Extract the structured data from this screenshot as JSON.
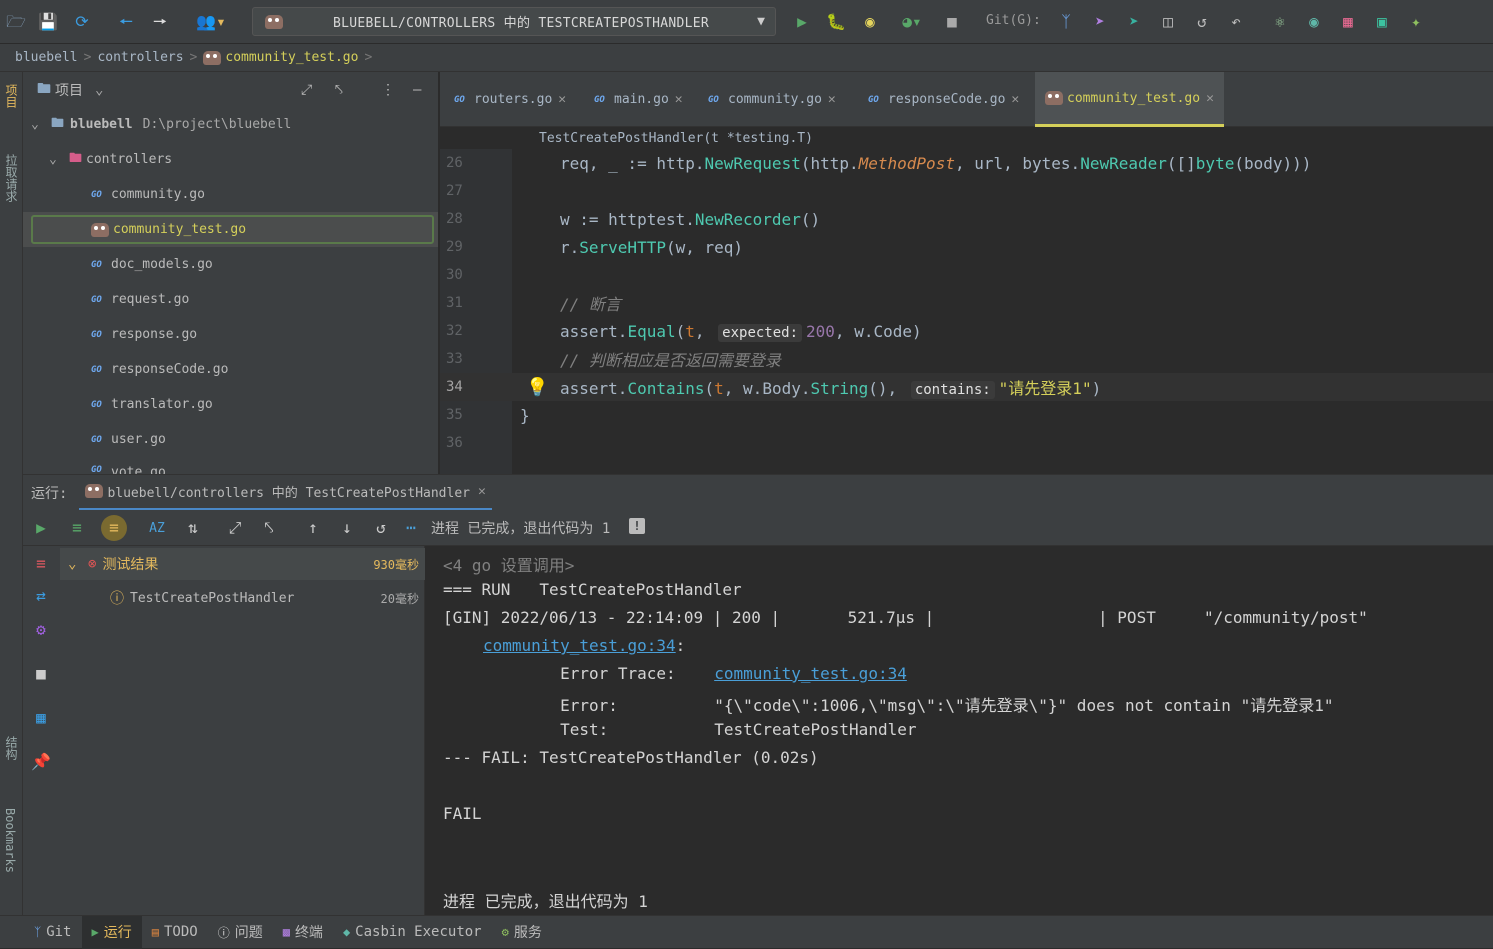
{
  "toolbar": {
    "run_config": "BLUEBELL/CONTROLLERS 中的 TESTCREATEPOSTHANDLER",
    "git_label": "Git(G):"
  },
  "breadcrumb": {
    "items": [
      "bluebell",
      "controllers",
      "community_test.go"
    ]
  },
  "left_strip": {
    "top_label_1": "项目",
    "top_label_2": "拉取请求",
    "bottom_label_1": "结构",
    "bottom_label_2": "Bookmarks"
  },
  "project": {
    "header": "项目",
    "root_name": "bluebell",
    "root_path": "D:\\project\\bluebell",
    "folder": "controllers",
    "files": [
      "community.go",
      "community_test.go",
      "doc_models.go",
      "request.go",
      "response.go",
      "responseCode.go",
      "translator.go",
      "user.go",
      "vote.go"
    ]
  },
  "tabs": [
    {
      "label": "routers.go"
    },
    {
      "label": "main.go"
    },
    {
      "label": "community.go"
    },
    {
      "label": "responseCode.go"
    },
    {
      "label": "community_test.go"
    }
  ],
  "editor": {
    "sticky": "TestCreatePostHandler(t *testing.T)",
    "line_numbers": [
      "26",
      "27",
      "28",
      "29",
      "30",
      "31",
      "32",
      "33",
      "34",
      "35",
      "36"
    ],
    "hint_expected": "expected:",
    "hint_contains": "contains:",
    "comment_1": "// 断言",
    "comment_2": "// 判断相应是否返回需要登录",
    "str_1": "\"请先登录1\"",
    "num_1": "200"
  },
  "run": {
    "label": "运行:",
    "tab": "bluebell/controllers 中的 TestCreatePostHandler",
    "status": "进程 已完成，退出代码为 1",
    "tree_root": "测试结果",
    "tree_root_time": "930毫秒",
    "tree_child": "TestCreatePostHandler",
    "tree_child_time": "20毫秒"
  },
  "console": {
    "lines": [
      "<4 go 设置调用>",
      "=== RUN   TestCreatePostHandler",
      "[GIN] 2022/06/13 - 22:14:09 | 200 |       521.7µs |                 | POST     \"/community/post\"",
      "",
      "        Error Trace:    ",
      "        Error:          \"{\\\"code\\\":1006,\\\"msg\\\":\\\"请先登录\\\"}\" does not contain \"请先登录1\"",
      "        Test:           TestCreatePostHandler",
      "--- FAIL: TestCreatePostHandler (0.02s)",
      "",
      "FAIL",
      "",
      "",
      "进程 已完成，退出代码为 1"
    ],
    "link_1": "community_test.go:34",
    "link_2": "community_test.go:34"
  },
  "bottom_bar": {
    "items": [
      "Git",
      "运行",
      "TODO",
      "问题",
      "终端",
      "Casbin Executor",
      "服务"
    ]
  },
  "colors": {
    "accent_yellow": "#d5d05a",
    "link_blue": "#4a9fd8",
    "run_green": "#59a869",
    "debug_red": "#db5860",
    "error_red": "#e05555",
    "warn_yellow": "#e4b95d"
  }
}
